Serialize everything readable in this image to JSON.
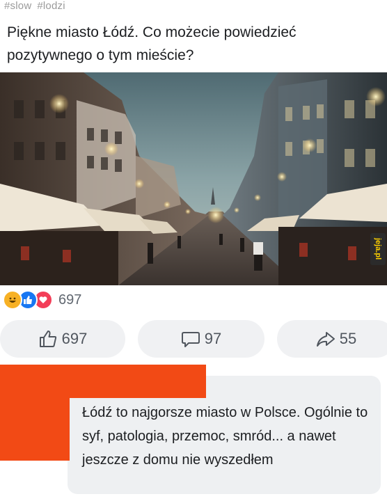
{
  "tags": [
    "#slow",
    "#lodzi"
  ],
  "post": {
    "text": "Piękne miasto Łódź. Co możecie powiedzieć pozytywnego o tym mieście?"
  },
  "watermark": "jeja.pl",
  "reactions": {
    "icons": [
      "haha-icon",
      "like-icon",
      "love-icon"
    ],
    "count": "697"
  },
  "actions": {
    "like_count": "697",
    "comment_count": "97",
    "share_count": "55"
  },
  "comment": {
    "text": "Łódź to najgorsze miasto w Polsce. Ogólnie to syf, patologia, przemoc, smród... a nawet jeszcze z domu nie wyszedłem"
  },
  "colors": {
    "redaction": "#f24a15",
    "like_blue": "#1877f2",
    "love_red": "#f33e58",
    "haha_yellow": "#f7b125",
    "button_bg": "#f0f1f3",
    "comment_bg": "#eef0f2"
  }
}
